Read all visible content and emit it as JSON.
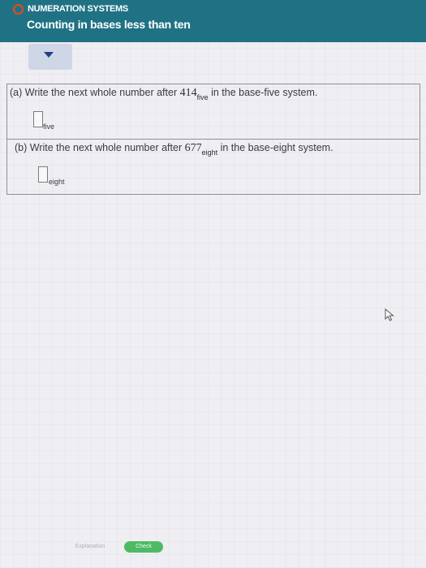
{
  "header": {
    "topic": "NUMERATION SYSTEMS",
    "title": "Counting in bases less than ten"
  },
  "questions": [
    {
      "prefix": "(a) Write the next whole number after ",
      "number": "414",
      "base_sub": "five",
      "suffix": " in the base-five system.",
      "answer_value": "",
      "answer_base": "five"
    },
    {
      "prefix": "(b) Write the next whole number after ",
      "number": "677",
      "base_sub": "eight",
      "suffix": " in the base-eight system.",
      "answer_value": "",
      "answer_base": "eight"
    }
  ],
  "footer": {
    "explanation_label": "Explanation",
    "check_label": "Check"
  },
  "colors": {
    "header": "#1f7283",
    "check": "#4fba64",
    "topic_dot": "#f0461b"
  },
  "icons": {
    "toggle": "chevron-down-icon",
    "pointer": "mouse-pointer-icon"
  }
}
